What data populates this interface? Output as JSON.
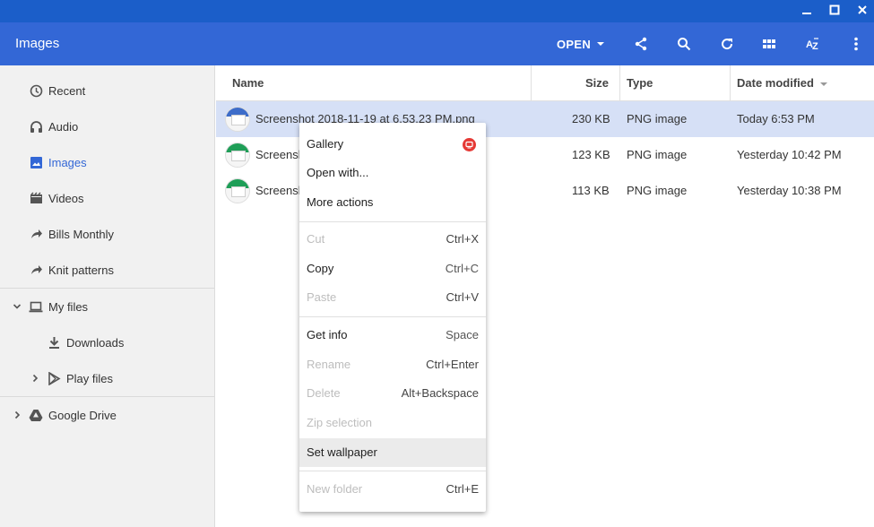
{
  "window": {
    "controls": {
      "minimize_icon": "minimize-icon",
      "maximize_icon": "maximize-icon",
      "close_icon": "close-icon"
    }
  },
  "header": {
    "title": "Images",
    "open_label": "OPEN",
    "icons": [
      "share-icon",
      "search-icon",
      "refresh-icon",
      "grid-view-icon",
      "sort-az-icon",
      "more-vert-icon"
    ]
  },
  "sidebar": {
    "recents": [
      {
        "label": "Recent",
        "icon": "clock-icon"
      },
      {
        "label": "Audio",
        "icon": "headphones-icon"
      },
      {
        "label": "Images",
        "icon": "image-icon",
        "active": true
      },
      {
        "label": "Videos",
        "icon": "clapperboard-icon"
      },
      {
        "label": "Bills Monthly",
        "icon": "shortcut-arrow-icon"
      },
      {
        "label": "Knit patterns",
        "icon": "shortcut-arrow-icon"
      }
    ],
    "my_files": {
      "label": "My files",
      "icon": "laptop-icon"
    },
    "downloads": {
      "label": "Downloads",
      "icon": "download-icon"
    },
    "play_files": {
      "label": "Play files",
      "icon": "play-store-icon"
    },
    "google_drive": {
      "label": "Google Drive",
      "icon": "drive-icon"
    }
  },
  "list": {
    "columns": {
      "name": "Name",
      "size": "Size",
      "type": "Type",
      "date": "Date modified"
    },
    "rows": [
      {
        "name": "Screenshot 2018-11-19 at 6.53.23 PM.png",
        "size": "230 KB",
        "type": "PNG image",
        "date": "Today 6:53 PM",
        "selected": true,
        "thumb_color": "#3d6cc9"
      },
      {
        "name": "Screensh",
        "size": "123 KB",
        "type": "PNG image",
        "date": "Yesterday 10:42 PM",
        "selected": false,
        "thumb_color": "#1e9e57"
      },
      {
        "name": "Screensh",
        "size": "113 KB",
        "type": "PNG image",
        "date": "Yesterday 10:38 PM",
        "selected": false,
        "thumb_color": "#1e9e57"
      }
    ]
  },
  "context_menu": {
    "gallery": "Gallery",
    "open_with": "Open with...",
    "more_actions": "More actions",
    "cut": {
      "label": "Cut",
      "shortcut": "Ctrl+X"
    },
    "copy": {
      "label": "Copy",
      "shortcut": "Ctrl+C"
    },
    "paste": {
      "label": "Paste",
      "shortcut": "Ctrl+V"
    },
    "get_info": {
      "label": "Get info",
      "shortcut": "Space"
    },
    "rename": {
      "label": "Rename",
      "shortcut": "Ctrl+Enter"
    },
    "delete": {
      "label": "Delete",
      "shortcut": "Alt+Backspace"
    },
    "zip": {
      "label": "Zip selection"
    },
    "set_wallpaper": {
      "label": "Set wallpaper"
    },
    "new_folder": {
      "label": "New folder",
      "shortcut": "Ctrl+E"
    }
  },
  "colors": {
    "title_strip": "#1b5ec9",
    "header": "#3367d6",
    "selection": "#d6e0f6",
    "gallery_badge": "#e53935"
  }
}
